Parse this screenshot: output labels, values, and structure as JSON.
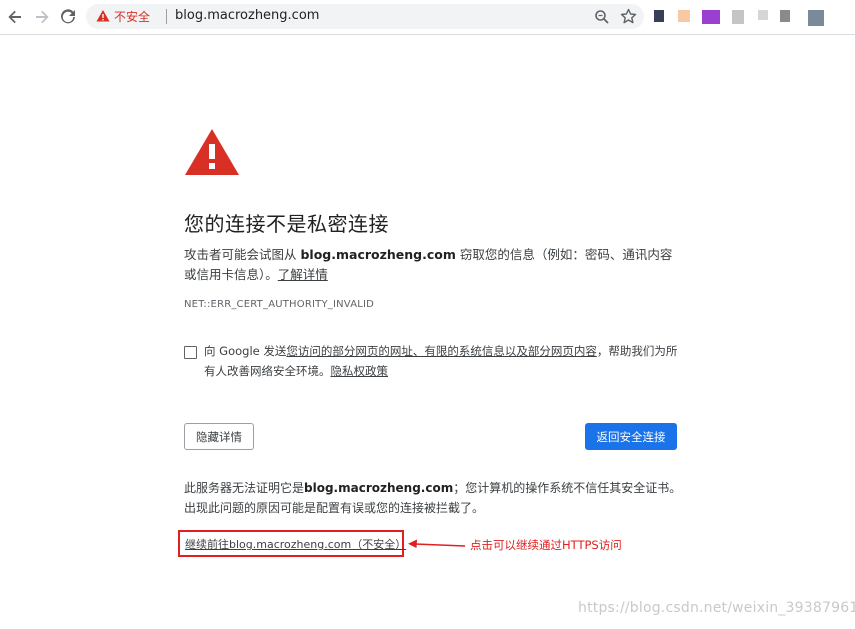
{
  "browser": {
    "insecure_label": "不安全",
    "url": "blog.macrozheng.com",
    "icons": {
      "back": "back-arrow-icon",
      "forward": "forward-arrow-icon",
      "reload": "reload-icon",
      "warning": "warning-triangle-icon",
      "zoom": "zoom-icon",
      "bookmark": "star-icon"
    },
    "colors": {
      "insecure": "#d93025",
      "omnibox_bg": "#f1f3f4"
    }
  },
  "interstitial": {
    "icon": "warning-triangle-icon",
    "heading": "您的连接不是私密连接",
    "explanation_prefix": "攻击者可能会试图从 ",
    "explanation_domain": "blog.macrozheng.com",
    "explanation_suffix": " 窃取您的信息（例如：密码、通讯内容或信用卡信息）。",
    "learn_more": "了解详情",
    "error_code": "NET::ERR_CERT_AUTHORITY_INVALID",
    "optin_prefix": "向 Google 发送",
    "optin_link": "您访问的部分网页的网址、有限的系统信息以及部分网页内容",
    "optin_middle": "，帮助我们为所有人改善网络安全环境。",
    "optin_privacy": "隐私权政策",
    "details_button": "隐藏详情",
    "primary_button": "返回安全连接",
    "details_prefix": "此服务器无法证明它是",
    "details_domain": "blog.macrozheng.com",
    "details_suffix": "；您计算机的操作系统不信任其安全证书。出现此问题的原因可能是配置有误或您的连接被拦截了。",
    "proceed_link": "继续前往blog.macrozheng.com（不安全）",
    "colors": {
      "warning_red": "#d93025",
      "primary": "#1a73e8"
    }
  },
  "annotation": {
    "text": "点击可以继续通过HTTPS访问",
    "color": "#e02020"
  },
  "watermark": "https://blog.csdn.net/weixin_39387961"
}
